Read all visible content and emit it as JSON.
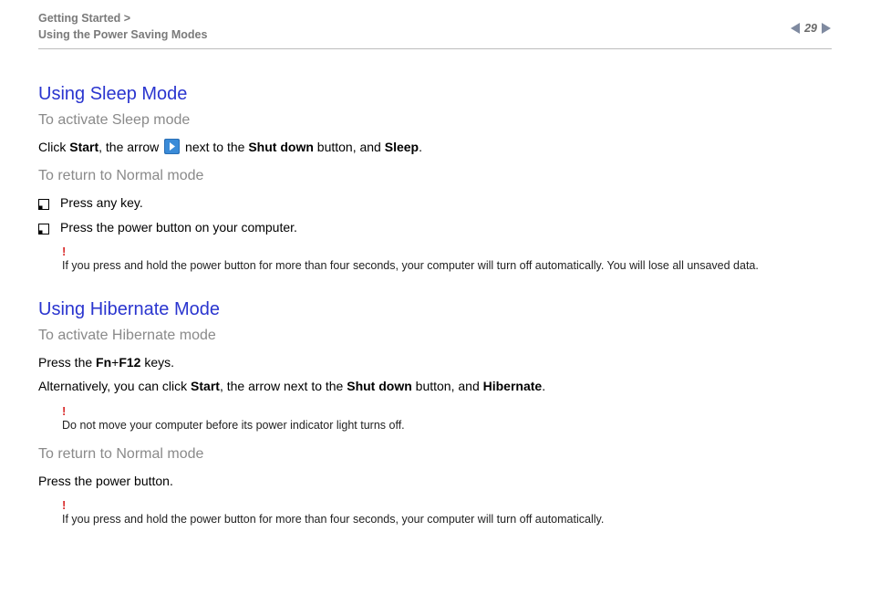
{
  "header": {
    "breadcrumb_line1": "Getting Started >",
    "breadcrumb_line2": "Using the Power Saving Modes",
    "page_number": "29"
  },
  "sleep": {
    "title": "Using Sleep Mode",
    "activate_heading": "To activate Sleep mode",
    "activate_pre": "Click ",
    "activate_start": "Start",
    "activate_mid1": ", the arrow ",
    "activate_mid2": " next to the ",
    "activate_shutdown": "Shut down",
    "activate_mid3": " button, and ",
    "activate_sleep": "Sleep",
    "activate_end": ".",
    "return_heading": "To return to Normal mode",
    "bullets": [
      "Press any key.",
      "Press the power button on your computer."
    ],
    "warning_bang": "!",
    "warning_text": "If you press and hold the power button for more than four seconds, your computer will turn off automatically. You will lose all unsaved data."
  },
  "hibernate": {
    "title": "Using Hibernate Mode",
    "activate_heading": "To activate Hibernate mode",
    "press_pre": "Press the ",
    "press_fn": "Fn",
    "press_plus": "+",
    "press_f12": "F12",
    "press_post": " keys.",
    "alt_pre": "Alternatively, you can click ",
    "alt_start": "Start",
    "alt_mid1": ", the arrow next to the ",
    "alt_shutdown": "Shut down",
    "alt_mid2": " button, and ",
    "alt_hibernate": "Hibernate",
    "alt_end": ".",
    "warning1_bang": "!",
    "warning1_text": "Do not move your computer before its power indicator light turns off.",
    "return_heading": "To return to Normal mode",
    "return_text": "Press the power button.",
    "warning2_bang": "!",
    "warning2_text": "If you press and hold the power button for more than four seconds, your computer will turn off automatically."
  }
}
